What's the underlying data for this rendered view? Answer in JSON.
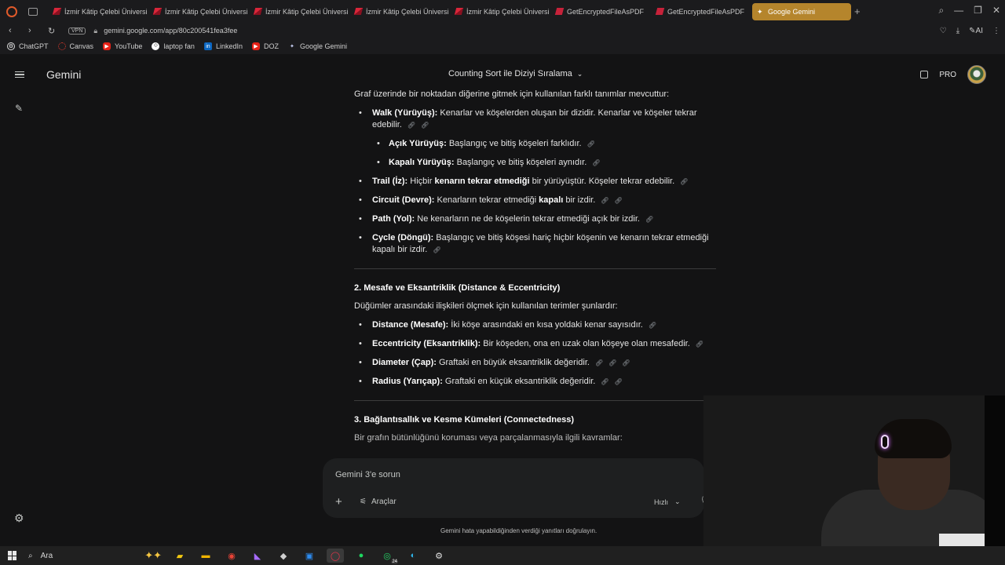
{
  "browser": {
    "tabs": [
      {
        "title": "İzmir Kâtip Çelebi Üniversi",
        "favicon": "ikc-icon"
      },
      {
        "title": "İzmir Kâtip Çelebi Üniversi",
        "favicon": "ikc-icon"
      },
      {
        "title": "İzmir Kâtip Çelebi Üniversi",
        "favicon": "ikc-icon"
      },
      {
        "title": "İzmir Kâtip Çelebi Üniversi",
        "favicon": "ikc-icon"
      },
      {
        "title": "İzmir Kâtip Çelebi Üniversi",
        "favicon": "ikc-icon"
      },
      {
        "title": "GetEncryptedFileAsPDF",
        "favicon": "pdf-icon"
      },
      {
        "title": "GetEncryptedFileAsPDF",
        "favicon": "pdf-icon"
      },
      {
        "title": "Google Gemini",
        "favicon": "gemini-icon",
        "active": true
      }
    ],
    "vpn_label": "VPN",
    "url": "gemini.google.com/app/80c200541fea3fee",
    "ai_label": "AI",
    "bookmarks": [
      {
        "label": "ChatGPT",
        "icon": "chatgpt-icon"
      },
      {
        "label": "Canvas",
        "icon": "canvas-icon"
      },
      {
        "label": "YouTube",
        "icon": "youtube-icon"
      },
      {
        "label": "laptop fan",
        "icon": "laptop-fan-icon"
      },
      {
        "label": "LinkedIn",
        "icon": "linkedin-icon"
      },
      {
        "label": "DOZ",
        "icon": "doz-icon"
      },
      {
        "label": "Google Gemini",
        "icon": "gemini-icon"
      }
    ],
    "accent_color": "#b5852c"
  },
  "app": {
    "name": "Gemini",
    "conversation_title": "Counting Sort ile Diziyi Sıralama",
    "plan_label": "PRO"
  },
  "content": {
    "intro": "Graf üzerinde bir noktadan diğerine gitmek için kullanılan farklı tanımlar mevcuttur:",
    "walk": {
      "term": "Walk (Yürüyüş):",
      "text": " Kenarlar ve köşelerden oluşan bir dizidir. Kenarlar ve köşeler tekrar edebilir."
    },
    "open_walk": {
      "term": "Açık Yürüyüş:",
      "text": " Başlangıç ve bitiş köşeleri farklıdır."
    },
    "closed_walk": {
      "term": "Kapalı Yürüyüş:",
      "text": " Başlangıç ve bitiş köşeleri aynıdır."
    },
    "trail": {
      "term": "Trail (İz):",
      "text_a": " Hiçbir ",
      "bold_a": "kenarın tekrar etmediği",
      "text_b": " bir yürüyüştür. Köşeler tekrar edebilir."
    },
    "circuit": {
      "term": "Circuit (Devre):",
      "text_a": " Kenarların tekrar etmediği ",
      "bold_a": "kapalı",
      "text_b": " bir izdir."
    },
    "path": {
      "term": "Path (Yol):",
      "text": " Ne kenarların ne de köşelerin tekrar etmediği açık bir izdir."
    },
    "cycle": {
      "term": "Cycle (Döngü):",
      "text": " Başlangıç ve bitiş köşesi hariç hiçbir köşenin ve kenarın tekrar etmediği kapalı bir izdir."
    },
    "section2": {
      "heading": "2. Mesafe ve Eksantriklik (Distance & Eccentricity)",
      "intro": "Düğümler arasındaki ilişkileri ölçmek için kullanılan terimler şunlardır:",
      "distance": {
        "term": "Distance (Mesafe):",
        "text": " İki köşe arasındaki en kısa yoldaki kenar sayısıdır."
      },
      "eccentricity": {
        "term": "Eccentricity (Eksantriklik):",
        "text": " Bir köşeden, ona en uzak olan köşeye olan mesafedir."
      },
      "diameter": {
        "term": "Diameter (Çap):",
        "text": " Graftaki en büyük eksantriklik değeridir."
      },
      "radius": {
        "term": "Radius (Yarıçap):",
        "text": " Graftaki en küçük eksantriklik değeridir."
      }
    },
    "section3": {
      "heading": "3. Bağlantısallık ve Kesme Kümeleri (Connectedness)",
      "intro": "Bir grafın bütünlüğünü koruması veya parçalanmasıyla ilgili kavramlar:"
    }
  },
  "composer": {
    "placeholder": "Gemini 3'e sorun",
    "tools_label": "Araçlar",
    "mode_label": "Hızlı"
  },
  "disclaimer": "Gemini hata yapabildiğinden verdiği yanıtları doğrulayın.",
  "taskbar": {
    "search_label": "Ara",
    "whatsapp_badge": "24"
  }
}
